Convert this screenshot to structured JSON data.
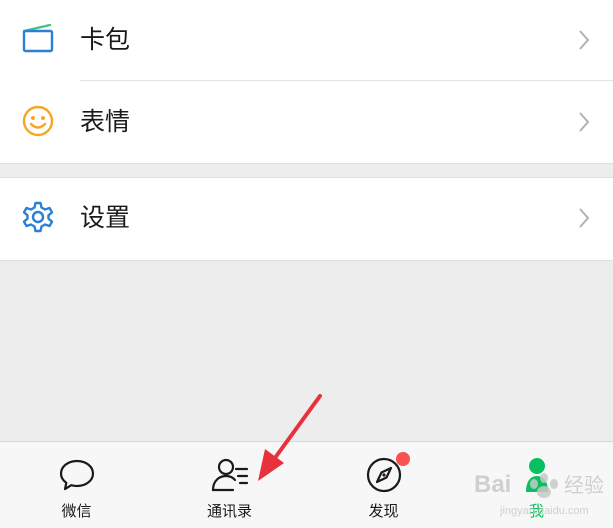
{
  "menu": {
    "card_wallet": {
      "label": "卡包",
      "icon": "card-wallet-icon"
    },
    "stickers": {
      "label": "表情",
      "icon": "smiley-icon"
    },
    "settings": {
      "label": "设置",
      "icon": "gear-icon"
    }
  },
  "tabbar": {
    "tabs": [
      {
        "label": "微信",
        "icon": "chat-bubble-icon"
      },
      {
        "label": "通讯录",
        "icon": "contacts-icon"
      },
      {
        "label": "发现",
        "icon": "compass-icon"
      },
      {
        "label": "我",
        "icon": "person-icon"
      }
    ],
    "active_index": 3,
    "badge_tab_index": 2
  },
  "colors": {
    "accent_green": "#07c160",
    "badge_red": "#fa5151",
    "icon_blue": "#2b7fd6",
    "icon_orange": "#f5a623",
    "annotation_arrow": "#e8313b"
  }
}
